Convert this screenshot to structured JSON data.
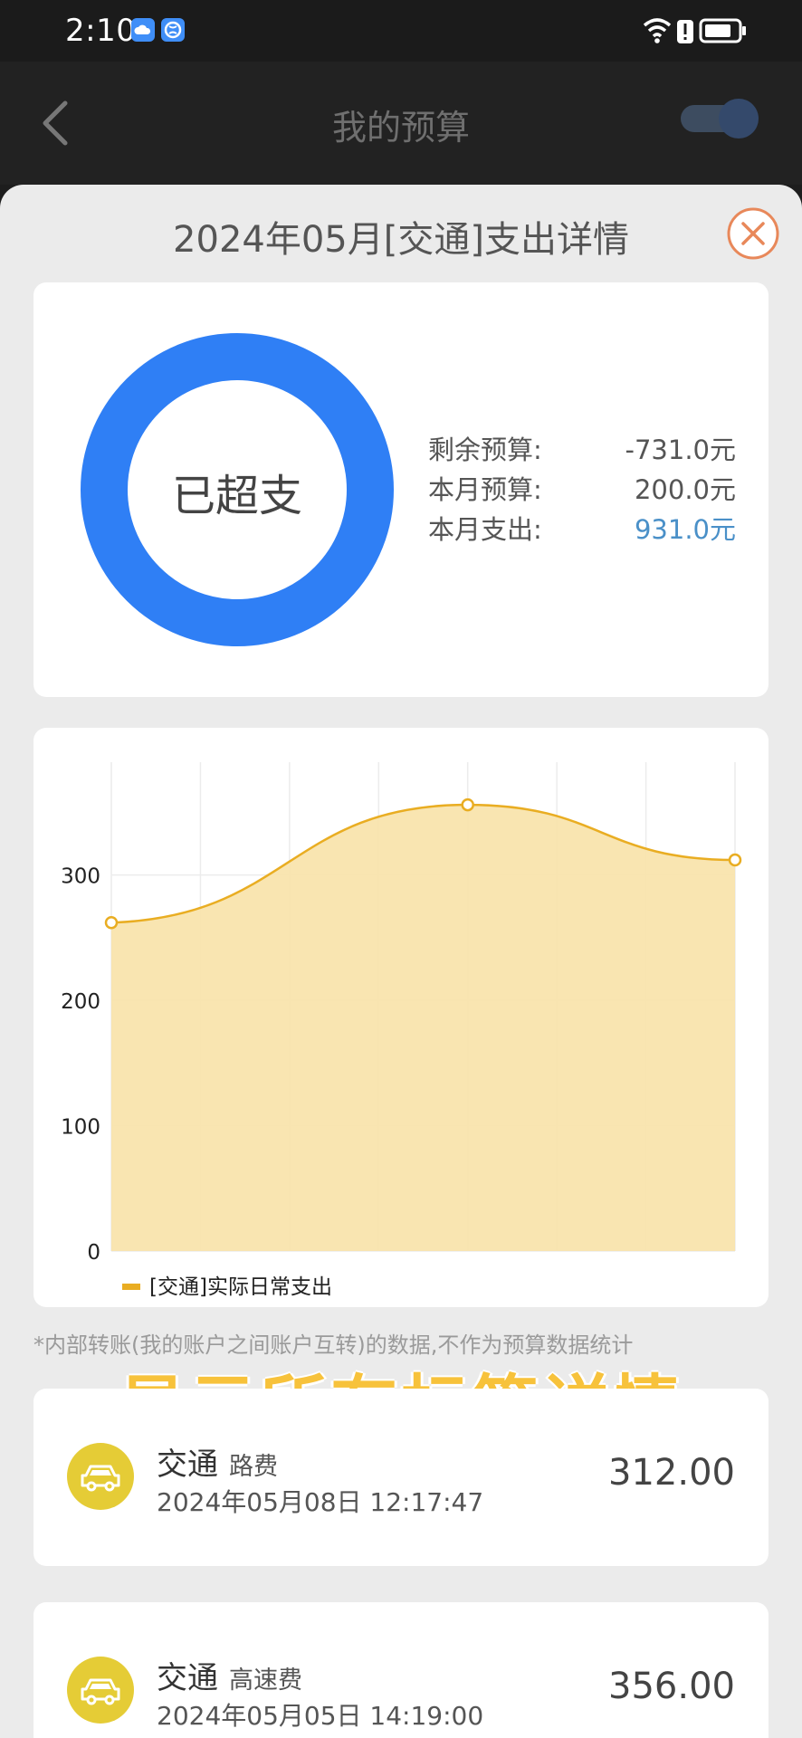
{
  "status_bar": {
    "time": "2:10"
  },
  "nav": {
    "title": "我的预算"
  },
  "sheet": {
    "title": "2024年05月[交通]支出详情"
  },
  "summary": {
    "donut_label": "已超支",
    "donut_color": "#2f7ff5",
    "rows": [
      {
        "label": "剩余预算:",
        "value": "-731.0元"
      },
      {
        "label": "本月预算:",
        "value": "200.0元"
      },
      {
        "label": "本月支出:",
        "value": "931.0元"
      }
    ]
  },
  "chart_data": {
    "type": "area",
    "x": [
      0,
      1,
      2,
      3,
      4,
      5,
      6,
      7
    ],
    "series": [
      {
        "name": "[交通]实际日常支出",
        "values": [
          262,
          null,
          null,
          null,
          356,
          null,
          null,
          312
        ]
      }
    ],
    "yticks": [
      "0",
      "100",
      "200",
      "300"
    ],
    "ylim": [
      0,
      390
    ],
    "grid": true,
    "legend_position": "bottom-left",
    "color": "#e9ad22",
    "fill": "#f9e4ad"
  },
  "note": "*内部转账(我的账户之间账户互转)的数据,不作为预算数据统计",
  "promo": "显示所有标签详情",
  "items": [
    {
      "category": "交通",
      "sub": "路费",
      "date": "2024年05月08日  12:17:47",
      "amount": "312.00"
    },
    {
      "category": "交通",
      "sub": "高速费",
      "date": "2024年05月05日  14:19:00",
      "amount": "356.00"
    }
  ]
}
